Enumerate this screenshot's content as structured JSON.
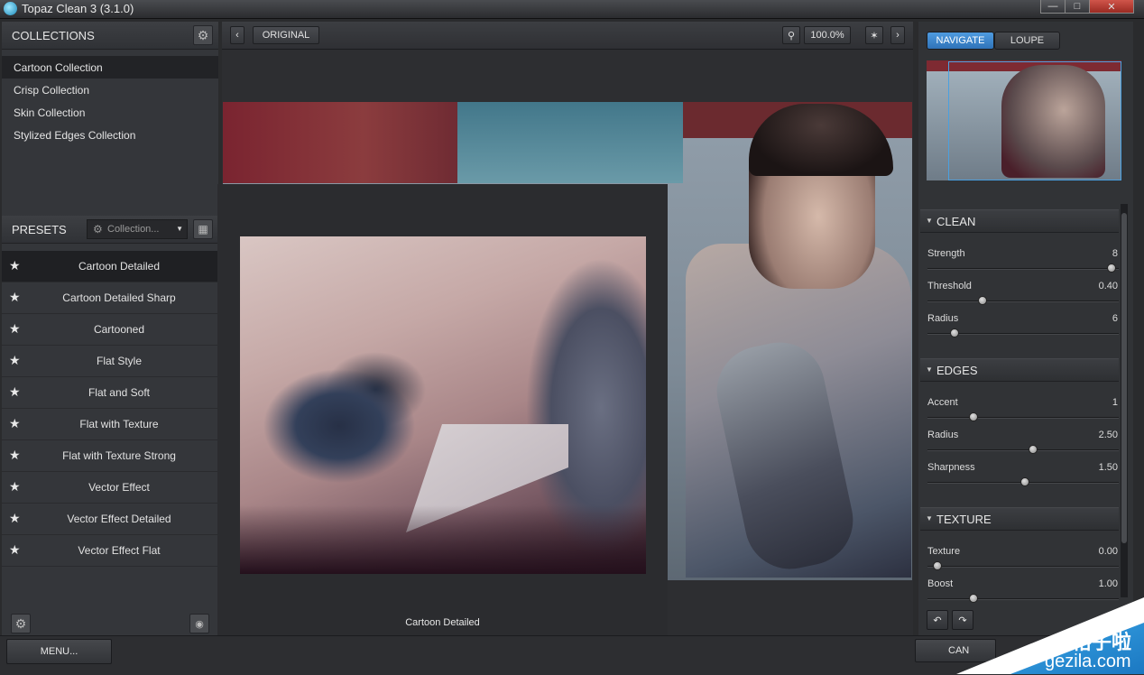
{
  "window": {
    "title": "Topaz Clean 3 (3.1.0)"
  },
  "collections": {
    "header": "COLLECTIONS",
    "items": [
      {
        "label": "Cartoon Collection",
        "selected": true
      },
      {
        "label": "Crisp Collection"
      },
      {
        "label": "Skin Collection"
      },
      {
        "label": "Stylized Edges Collection"
      }
    ]
  },
  "presets": {
    "header": "PRESETS",
    "dropdown": "Collection...",
    "items": [
      {
        "label": "Cartoon Detailed",
        "selected": true
      },
      {
        "label": "Cartoon Detailed Sharp"
      },
      {
        "label": "Cartooned"
      },
      {
        "label": "Flat Style"
      },
      {
        "label": "Flat and Soft"
      },
      {
        "label": "Flat with Texture"
      },
      {
        "label": "Flat with Texture Strong"
      },
      {
        "label": "Vector Effect"
      },
      {
        "label": "Vector Effect Detailed"
      },
      {
        "label": "Vector Effect Flat"
      }
    ]
  },
  "toolbar": {
    "original_label": "ORIGINAL",
    "zoom": "100.0%"
  },
  "preview": {
    "caption": "Cartoon Detailed"
  },
  "right": {
    "tabs": [
      {
        "label": "NAVIGATE",
        "active": true
      },
      {
        "label": "LOUPE"
      }
    ],
    "sections": {
      "clean": {
        "title": "CLEAN",
        "sliders": [
          {
            "label": "Strength",
            "value": "8",
            "pos": 0.96
          },
          {
            "label": "Threshold",
            "value": "0.40",
            "pos": 0.29
          },
          {
            "label": "Radius",
            "value": "6",
            "pos": 0.14
          }
        ]
      },
      "edges": {
        "title": "EDGES",
        "sliders": [
          {
            "label": "Accent",
            "value": "1",
            "pos": 0.24
          },
          {
            "label": "Radius",
            "value": "2.50",
            "pos": 0.55
          },
          {
            "label": "Sharpness",
            "value": "1.50",
            "pos": 0.51
          }
        ]
      },
      "texture": {
        "title": "TEXTURE",
        "sliders": [
          {
            "label": "Texture",
            "value": "0.00",
            "pos": 0.05
          },
          {
            "label": "Boost",
            "value": "1.00",
            "pos": 0.24
          }
        ]
      }
    }
  },
  "bottom": {
    "menu_label": "MENU...",
    "cancel_label": "CAN"
  },
  "watermark": {
    "cn": "格子啦",
    "en": "gezila.com"
  },
  "colors": {
    "accent": "#3d8fd4",
    "panel": "#34363a"
  }
}
